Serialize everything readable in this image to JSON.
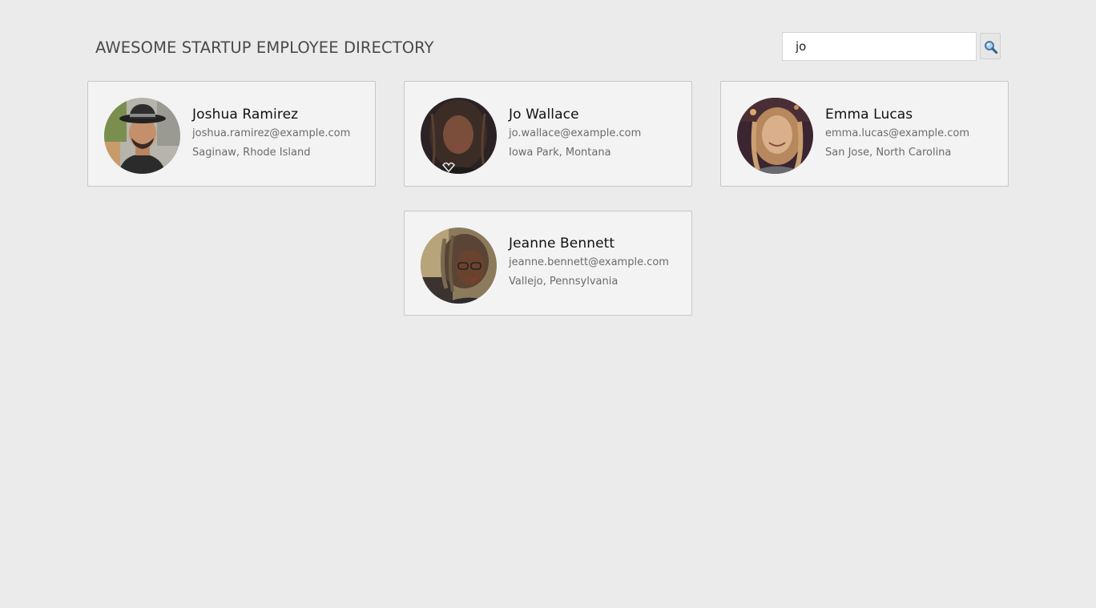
{
  "header": {
    "title": "AWESOME STARTUP EMPLOYEE DIRECTORY"
  },
  "search": {
    "value": "jo",
    "button_icon": "magnifier-icon"
  },
  "employees": [
    {
      "name": "Joshua Ramirez",
      "email": "joshua.ramirez@example.com",
      "location": "Saginaw, Rhode Island"
    },
    {
      "name": "Jo Wallace",
      "email": "jo.wallace@example.com",
      "location": "Iowa Park, Montana"
    },
    {
      "name": "Emma Lucas",
      "email": "emma.lucas@example.com",
      "location": "San Jose, North Carolina"
    },
    {
      "name": "Jeanne Bennett",
      "email": "jeanne.bennett@example.com",
      "location": "Vallejo, Pennsylvania"
    }
  ],
  "colors": {
    "page_background": "#ebebeb",
    "card_background": "#f3f3f3",
    "card_border": "#c8c8c8",
    "name_text": "#111111",
    "detail_text": "#6b6b6b"
  }
}
